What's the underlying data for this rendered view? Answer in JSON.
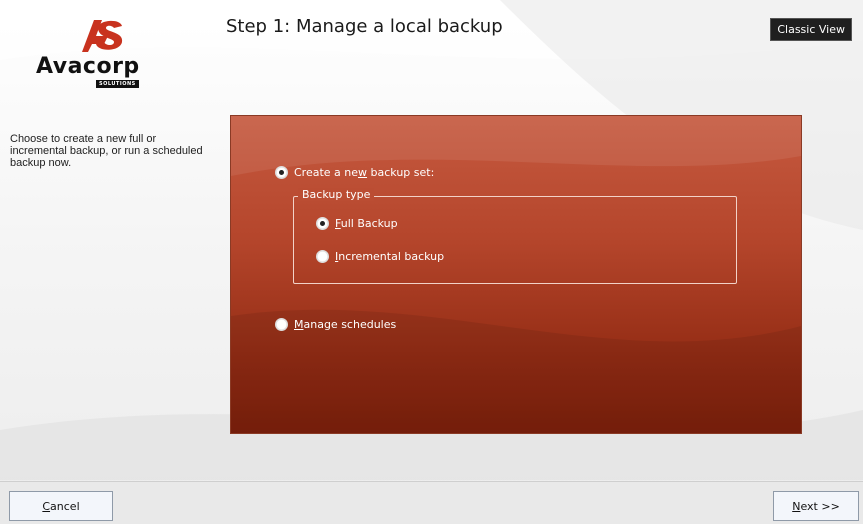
{
  "brand": {
    "logo_text": "Avacorp",
    "logo_sub": "SOLUTIONS",
    "accent": "#b84a30"
  },
  "header": {
    "title": "Step 1: Manage a local backup",
    "classic_view_label": "Classic View"
  },
  "sidebar": {
    "description": "Choose to create a new full or incremental backup, or run a scheduled backup now."
  },
  "options": {
    "create_new": {
      "label_pre": "Create a ne",
      "label_ul": "w",
      "label_post": " backup set:",
      "selected": true
    },
    "backup_type": {
      "legend": "Backup type",
      "full": {
        "label_ul": "F",
        "label_post": "ull Backup",
        "selected": true
      },
      "incremental": {
        "label_ul": "I",
        "label_post": "ncremental backup",
        "selected": false
      }
    },
    "manage_schedules": {
      "label_ul": "M",
      "label_post": "anage schedules",
      "selected": false
    }
  },
  "footer": {
    "cancel": {
      "label_ul": "C",
      "label_post": "ancel"
    },
    "next": {
      "label_ul": "N",
      "label_post": "ext >>"
    }
  }
}
